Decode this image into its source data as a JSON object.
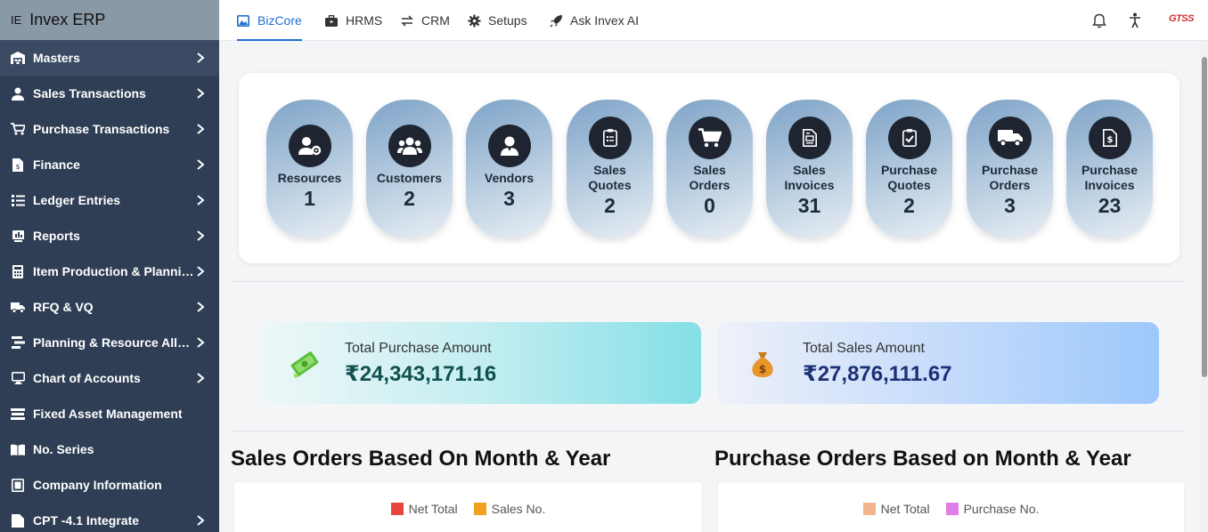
{
  "brand": {
    "abbr": "IE",
    "name": "Invex ERP"
  },
  "sidebar": {
    "items": [
      {
        "label": "Masters",
        "icon": "warehouse-icon",
        "has_submenu": true
      },
      {
        "label": "Sales Transactions",
        "icon": "user-tie-icon",
        "has_submenu": true
      },
      {
        "label": "Purchase Transactions",
        "icon": "cart-icon",
        "has_submenu": true
      },
      {
        "label": "Finance",
        "icon": "invoice-dollar-icon",
        "has_submenu": true
      },
      {
        "label": "Ledger Entries",
        "icon": "list-icon",
        "has_submenu": true
      },
      {
        "label": "Reports",
        "icon": "report-icon",
        "has_submenu": true
      },
      {
        "label": "Item Production & Planning",
        "icon": "calculator-icon",
        "has_submenu": true
      },
      {
        "label": "RFQ & VQ",
        "icon": "truck-icon",
        "has_submenu": true
      },
      {
        "label": "Planning & Resource Allocation",
        "icon": "planning-icon",
        "has_submenu": true
      },
      {
        "label": "Chart of Accounts",
        "icon": "monitor-icon",
        "has_submenu": true
      },
      {
        "label": "Fixed Asset Management",
        "icon": "asset-icon",
        "has_submenu": false
      },
      {
        "label": "No. Series",
        "icon": "book-icon",
        "has_submenu": false
      },
      {
        "label": "Company Information",
        "icon": "company-icon",
        "has_submenu": false
      },
      {
        "label": "CPT -4.1 Integrate",
        "icon": "code-icon",
        "has_submenu": true
      }
    ]
  },
  "topbar": {
    "tabs": [
      {
        "label": "BizCore",
        "icon": "image-icon",
        "active": true
      },
      {
        "label": "HRMS",
        "icon": "briefcase-icon",
        "active": false
      },
      {
        "label": "CRM",
        "icon": "sync-icon",
        "active": false
      },
      {
        "label": "Setups",
        "icon": "gear-icon",
        "active": false
      },
      {
        "label": "Ask Invex AI",
        "icon": "rocket-icon",
        "active": false
      }
    ],
    "logo_text": "GTSS"
  },
  "kpis": [
    {
      "label_lines": [
        "Resources"
      ],
      "value": "1",
      "icon": "user-gear-icon"
    },
    {
      "label_lines": [
        "Customers"
      ],
      "value": "2",
      "icon": "users-icon"
    },
    {
      "label_lines": [
        "Vendors"
      ],
      "value": "3",
      "icon": "vendor-icon"
    },
    {
      "label_lines": [
        "Sales",
        "Quotes"
      ],
      "value": "2",
      "icon": "clipboard-list-icon"
    },
    {
      "label_lines": [
        "Sales",
        "Orders"
      ],
      "value": "0",
      "icon": "cart-icon"
    },
    {
      "label_lines": [
        "Sales",
        "Invoices"
      ],
      "value": "31",
      "icon": "invoice-icon"
    },
    {
      "label_lines": [
        "Purchase",
        "Quotes"
      ],
      "value": "2",
      "icon": "clipboard-check-icon"
    },
    {
      "label_lines": [
        "Purchase",
        "Orders"
      ],
      "value": "3",
      "icon": "truck-icon"
    },
    {
      "label_lines": [
        "Purchase",
        "Invoices"
      ],
      "value": "23",
      "icon": "invoice-dollar-icon"
    }
  ],
  "amounts": {
    "purchase": {
      "label": "Total Purchase Amount",
      "value": "₹24,343,171.16",
      "icon": "money-icon"
    },
    "sales": {
      "label": "Total Sales Amount",
      "value": "₹27,876,111.67",
      "icon": "money-bag-icon"
    }
  },
  "charts": {
    "sales_orders": {
      "title": "Sales Orders Based On Month & Year",
      "legend": [
        {
          "label": "Net Total",
          "color": "#e8453c"
        },
        {
          "label": "Sales No.",
          "color": "#f0a21f"
        }
      ]
    },
    "purchase_orders": {
      "title": "Purchase Orders Based on Month & Year",
      "legend": [
        {
          "label": "Net Total",
          "color": "#f2b48a"
        },
        {
          "label": "Purchase No.",
          "color": "#e07ee8"
        }
      ]
    }
  }
}
